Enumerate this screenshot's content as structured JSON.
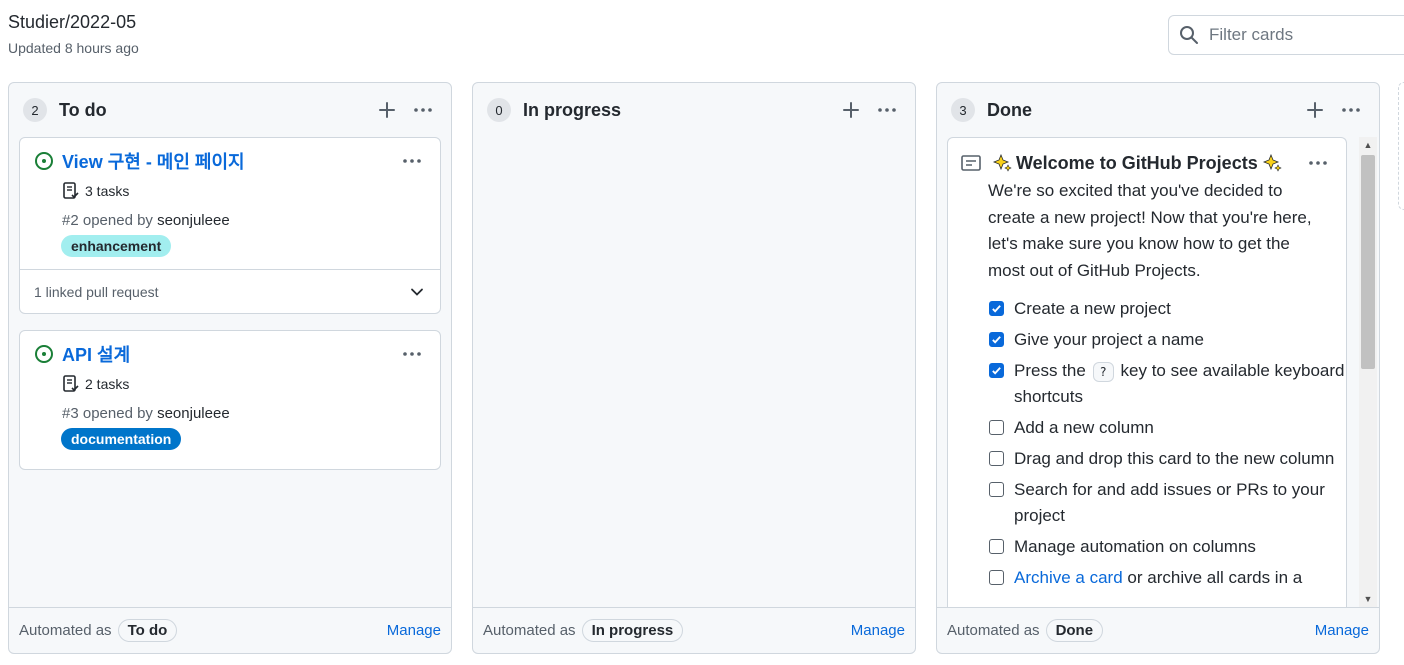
{
  "header": {
    "title": "Studier/2022-05",
    "updated": "Updated 8 hours ago"
  },
  "filter": {
    "placeholder": "Filter cards"
  },
  "columns": [
    {
      "count": "2",
      "title": "To do",
      "cards": [
        {
          "title": "View 구현 - 메인 페이지",
          "tasks": "3 tasks",
          "opened_prefix": "#2 opened by",
          "user": "seonjuleee",
          "label": {
            "text": "enhancement",
            "bg": "#a2eeef",
            "fg": "#24292f"
          },
          "linked": "1 linked pull request"
        },
        {
          "title": "API 설계",
          "tasks": "2 tasks",
          "opened_prefix": "#3 opened by",
          "user": "seonjuleee",
          "label": {
            "text": "documentation",
            "bg": "#0075ca",
            "fg": "#ffffff"
          }
        }
      ],
      "footer": {
        "automated": "Automated as",
        "pill": "To do",
        "manage": "Manage"
      }
    },
    {
      "count": "0",
      "title": "In progress",
      "cards": [],
      "footer": {
        "automated": "Automated as",
        "pill": "In progress",
        "manage": "Manage"
      }
    },
    {
      "count": "3",
      "title": "Done",
      "note": {
        "title": "Welcome to GitHub Projects",
        "body": "We're so excited that you've decided to create a new project! Now that you're here, let's make sure you know how to get the most out of GitHub Projects.",
        "checklist": [
          {
            "text": "Create a new project",
            "checked": true
          },
          {
            "text": "Give your project a name",
            "checked": true
          },
          {
            "pre": "Press the",
            "key": "?",
            "post": "key to see available keyboard shortcuts",
            "checked": true
          },
          {
            "text": "Add a new column",
            "checked": false
          },
          {
            "text": "Drag and drop this card to the new column",
            "checked": false
          },
          {
            "text": "Search for and add issues or PRs to your project",
            "checked": false
          },
          {
            "text": "Manage automation on columns",
            "checked": false
          },
          {
            "link": "Archive a card",
            "post": "or archive all cards in a",
            "checked": false
          }
        ]
      },
      "footer": {
        "automated": "Automated as",
        "pill": "Done",
        "manage": "Manage"
      }
    }
  ]
}
